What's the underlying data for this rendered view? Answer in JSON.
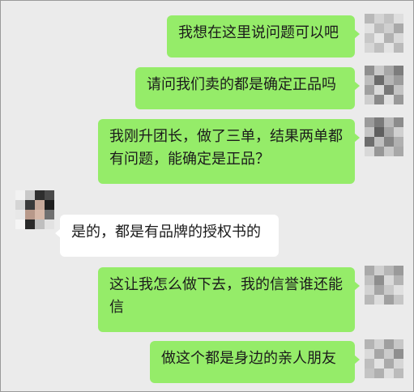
{
  "colors": {
    "outgoing_bubble": "#95ec69",
    "incoming_bubble": "#ffffff",
    "background": "#ebebeb"
  },
  "messages": [
    {
      "text": "我想在这里说问题可以吧"
    },
    {
      "text": "请问我们卖的都是确定正品吗"
    },
    {
      "text": "我刚升团长，做了三单，结果两单都有问题，能确定是正品？"
    },
    {
      "text": "是的，都是有品牌的授权书的"
    },
    {
      "text": "这让我怎么做下去，我的信誉谁还能信"
    },
    {
      "text": "做这个都是身边的亲人朋友"
    }
  ]
}
